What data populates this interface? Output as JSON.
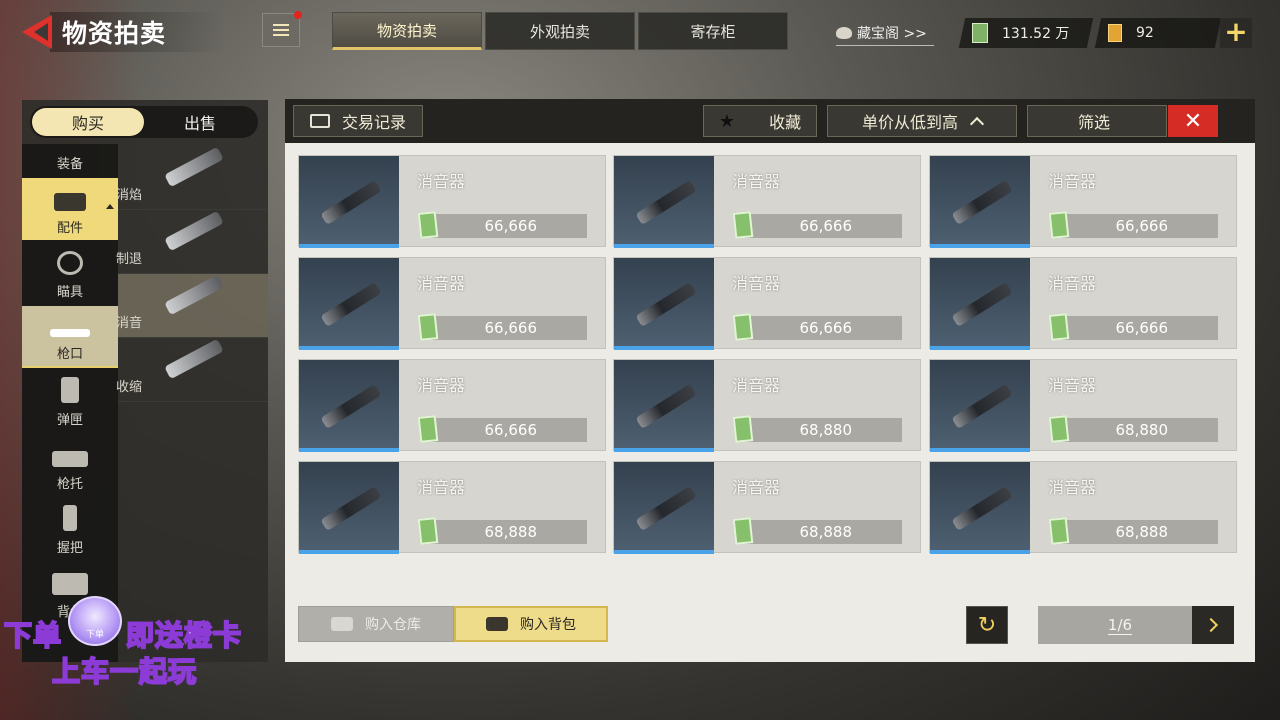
{
  "header": {
    "title": "物资拍卖",
    "tabs": [
      {
        "label": "物资拍卖",
        "active": true
      },
      {
        "label": "外观拍卖",
        "active": false
      },
      {
        "label": "寄存柜",
        "active": false
      }
    ],
    "treasure_link": "藏宝阁 >>",
    "cash_amount": "131.52 万",
    "coupon_amount": "92",
    "plus": "+"
  },
  "sidebar": {
    "mode_tabs": [
      {
        "label": "购买",
        "active": true
      },
      {
        "label": "出售",
        "active": false
      }
    ],
    "categories": [
      {
        "label": "装备",
        "icon": "vest-icon",
        "state": "normal"
      },
      {
        "label": "配件",
        "icon": "attachment-icon",
        "state": "active"
      },
      {
        "label": "瞄具",
        "icon": "scope-icon",
        "state": "normal"
      },
      {
        "label": "枪口",
        "icon": "muzzle-icon",
        "state": "selected"
      },
      {
        "label": "弹匣",
        "icon": "magazine-icon",
        "state": "normal"
      },
      {
        "label": "枪托",
        "icon": "stock-icon",
        "state": "normal"
      },
      {
        "label": "握把",
        "icon": "grip-icon",
        "state": "normal"
      },
      {
        "label": "背包",
        "icon": "backpack-icon",
        "state": "normal"
      }
    ],
    "subcategories": [
      {
        "label": "消焰",
        "selected": false
      },
      {
        "label": "制退",
        "selected": false
      },
      {
        "label": "消音",
        "selected": true
      },
      {
        "label": "收缩",
        "selected": false
      }
    ]
  },
  "toolbar": {
    "record": "交易记录",
    "favorite": "收藏",
    "sort": "单价从低到高",
    "filter": "筛选",
    "close": "✕"
  },
  "items": [
    {
      "name": "消音器",
      "price": "66,666"
    },
    {
      "name": "消音器",
      "price": "66,666"
    },
    {
      "name": "消音器",
      "price": "66,666"
    },
    {
      "name": "消音器",
      "price": "66,666"
    },
    {
      "name": "消音器",
      "price": "66,666"
    },
    {
      "name": "消音器",
      "price": "66,666"
    },
    {
      "name": "消音器",
      "price": "66,666"
    },
    {
      "name": "消音器",
      "price": "68,880"
    },
    {
      "name": "消音器",
      "price": "68,880"
    },
    {
      "name": "消音器",
      "price": "68,888"
    },
    {
      "name": "消音器",
      "price": "68,888"
    },
    {
      "name": "消音器",
      "price": "68,888"
    }
  ],
  "footer": {
    "warehouse_label": "购入仓库",
    "bag_label": "购入背包",
    "refresh": "↻",
    "page": "1/6"
  },
  "overlay": {
    "line1_left": "下单",
    "line1_right": "即送橙卡",
    "line2": "上车一起玩",
    "avatar_text": "下单"
  },
  "colors": {
    "accent_gold": "#e2c36a",
    "close_red": "#d62c26",
    "thumb_underline_blue": "#4aa3e8"
  }
}
